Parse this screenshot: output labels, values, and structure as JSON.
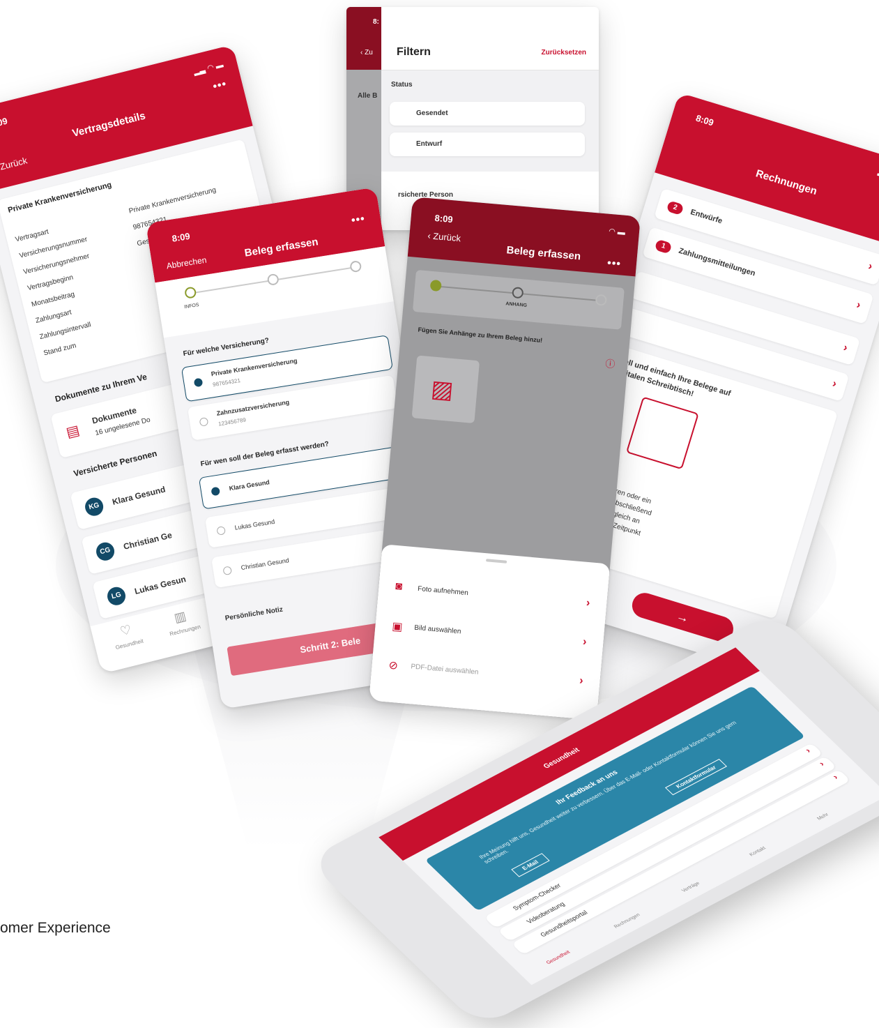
{
  "footer_text": "omer Experience",
  "status_time": "8:09",
  "vertrag": {
    "back": "Zurück",
    "title": "Vertragsdetails",
    "section": "Private Krankenversicherung",
    "rows": [
      {
        "label": "Vertragsart",
        "value": "Private Krankenversicherung"
      },
      {
        "label": "Versicherungsnummer",
        "value": "987654321"
      },
      {
        "label": "Versicherungsnehmer",
        "value": "Gesund, Klara"
      },
      {
        "label": "Vertragsbeginn",
        "value": ""
      },
      {
        "label": "Monatsbeitrag",
        "value": ""
      },
      {
        "label": "Zahlungsart",
        "value": ""
      },
      {
        "label": "Zahlungsintervall",
        "value": ""
      },
      {
        "label": "Stand zum",
        "value": ""
      }
    ],
    "docs_heading": "Dokumente zu Ihrem Ve",
    "docs_title": "Dokumente",
    "docs_sub": "16 ungelesene Do",
    "persons_heading": "Versicherte Personen",
    "persons": [
      {
        "initials": "KG",
        "name": "Klara Gesund"
      },
      {
        "initials": "CG",
        "name": "Christian Ge"
      },
      {
        "initials": "LG",
        "name": "Lukas Gesun"
      }
    ],
    "tab_health": "Gesundheit",
    "tab_invoices": "Rechnungen"
  },
  "filter": {
    "time": "8:",
    "back": "Zu",
    "title": "Filtern",
    "reset": "Zurücksetzen",
    "all": "Alle B",
    "status_heading": "Status",
    "options": [
      "Gesendet",
      "Entwurf"
    ],
    "person_heading": "rsicherte Person"
  },
  "beleg1": {
    "cancel": "Abbrechen",
    "title": "Beleg erfassen",
    "step1": "INFOS",
    "q1": "Für welche Versicherung?",
    "ins": [
      {
        "name": "Private Krankenversicherung",
        "num": "987654321"
      },
      {
        "name": "Zahnzusatzversicherung",
        "num": "123456789"
      }
    ],
    "q2": "Für wen soll der Beleg erfasst werden?",
    "persons": [
      "Klara Gesund",
      "Lukas Gesund",
      "Christian Gesund"
    ],
    "note": "Persönliche Notiz",
    "next": "Schritt 2: Bele"
  },
  "beleg2": {
    "back": "Zurück",
    "title": "Beleg erfassen",
    "step2": "ANHANG",
    "prompt": "Fügen Sie Anhänge zu Ihrem Beleg hinzu!",
    "actions": [
      "Foto aufnehmen",
      "Bild auswählen",
      "PDF-Datei auswählen"
    ]
  },
  "rechnungen": {
    "title": "Rechnungen",
    "items": [
      {
        "badge": "2",
        "label": "Entwürfe"
      },
      {
        "badge": "1",
        "label": "Zahlungsmitteilungen"
      }
    ],
    "promo_line1": "ell und einfach Ihre Belege auf",
    "promo_line2": "gitalen Schreibtisch!",
    "tips": [
      "fotografieren oder ein",
      "chladen. Abschließend",
      "den Beleg gleich an",
      "m späteren Zeitpunkt"
    ],
    "tab_mehr": "Mehr"
  },
  "device": {
    "title": "Gesundheit",
    "banner_title": "Ihr Feedback an uns",
    "banner_text": "Ihre Meinung hilft uns, Gesundheit weiter zu verbessern. Über das E-Mail- oder Kontaktformular können Sie uns gern schreiben.",
    "btn_mail": "E-Mail",
    "btn_form": "Kontaktformular",
    "items": [
      "Symptom-Checker",
      "Videoberatung",
      "Gesundheitsportal"
    ],
    "tabs": [
      "Gesundheit",
      "Rechnungen",
      "Verträge",
      "Kontakt",
      "Mehr"
    ]
  },
  "colors": {
    "brand": "#c8102e",
    "accent": "#124a67"
  }
}
